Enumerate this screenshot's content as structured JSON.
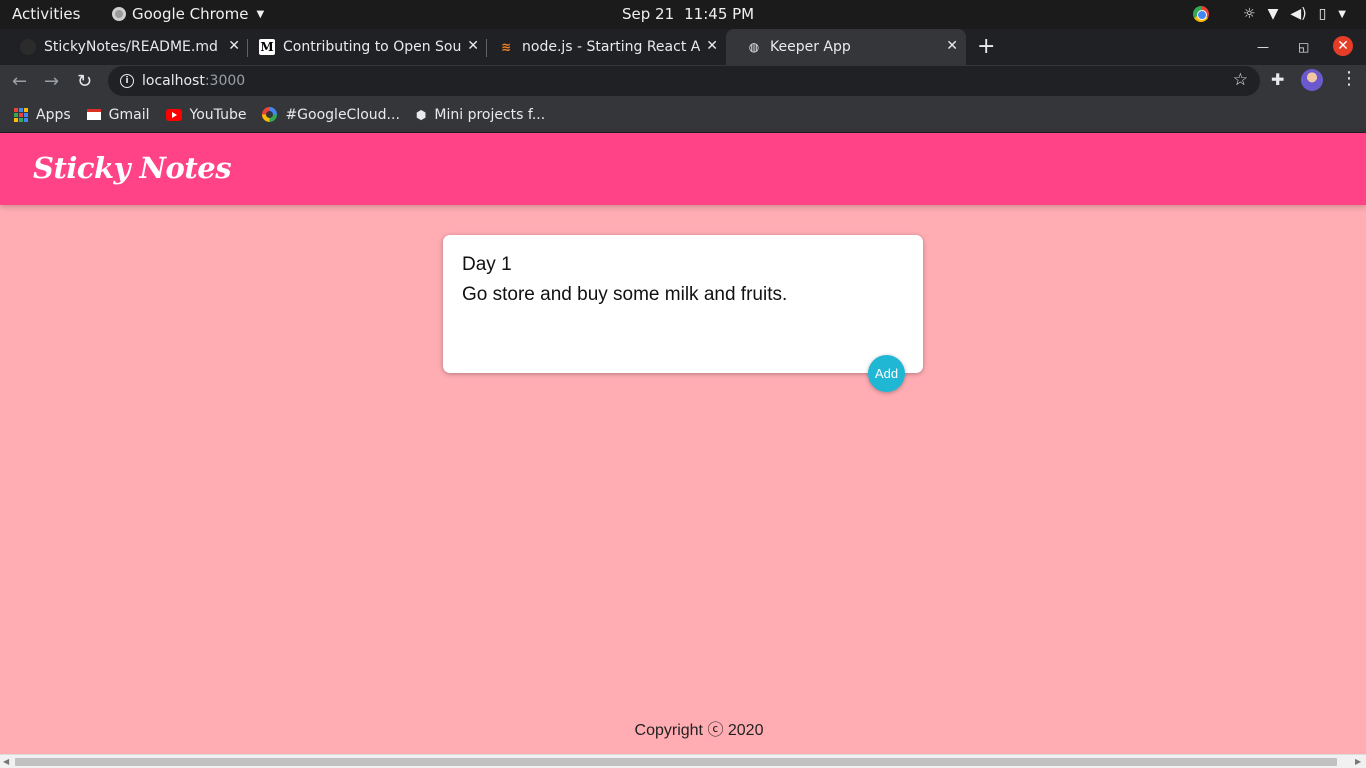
{
  "system_bar": {
    "activities": "Activities",
    "app_name": "Google Chrome",
    "date": "Sep 21",
    "time": "11:45 PM"
  },
  "tabs": [
    {
      "title": "StickyNotes/README.md",
      "icon": "github-icon"
    },
    {
      "title": "Contributing to Open Source",
      "icon": "medium-icon"
    },
    {
      "title": "node.js - Starting React App",
      "icon": "stackoverflow-icon"
    },
    {
      "title": "Keeper App",
      "icon": "globe-icon",
      "active": true
    }
  ],
  "address_bar": {
    "host": "localhost",
    "port": ":3000"
  },
  "bookmarks": [
    {
      "label": "Apps"
    },
    {
      "label": "Gmail"
    },
    {
      "label": "YouTube"
    },
    {
      "label": "#GoogleCloud..."
    },
    {
      "label": "Mini projects f..."
    }
  ],
  "app": {
    "title": "Sticky Notes"
  },
  "note": {
    "title": "Day 1",
    "content": "Go store and buy some milk and fruits.",
    "add_label": "Add"
  },
  "footer": {
    "copyright": "Copyright ⓒ 2020"
  },
  "colors": {
    "page_bg": "#ffacb3",
    "header_bg": "#ff4386",
    "add_button": "#1fb7d4"
  }
}
